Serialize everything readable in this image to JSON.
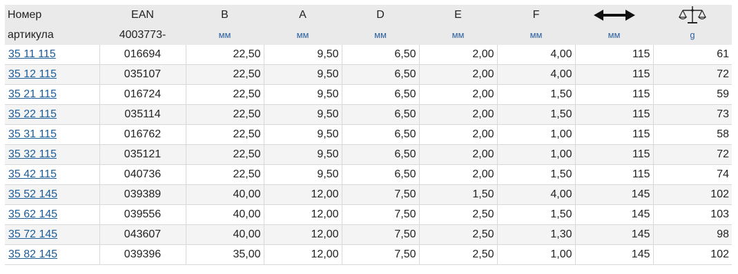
{
  "header": {
    "col_article_line1": "Номер",
    "col_article_line2": "артикула",
    "col_ean_line1": "EAN",
    "col_ean_line2": "4003773-",
    "col_b": "B",
    "col_a": "A",
    "col_d": "D",
    "col_e": "E",
    "col_f": "F",
    "length_icon": "double-arrow-icon",
    "weight_icon": "scale-icon",
    "units": {
      "b": "мм",
      "a": "мм",
      "d": "мм",
      "e": "мм",
      "f": "мм",
      "length": "мм",
      "weight": "g"
    }
  },
  "rows": [
    {
      "article": "35 11 115",
      "ean": "016694",
      "b": "22,50",
      "a": "9,50",
      "d": "6,50",
      "e": "2,00",
      "f": "4,00",
      "length": "115",
      "weight": "61"
    },
    {
      "article": "35 12 115",
      "ean": "035107",
      "b": "22,50",
      "a": "9,50",
      "d": "6,50",
      "e": "2,00",
      "f": "4,00",
      "length": "115",
      "weight": "72"
    },
    {
      "article": "35 21 115",
      "ean": "016724",
      "b": "22,50",
      "a": "9,50",
      "d": "6,50",
      "e": "2,00",
      "f": "1,50",
      "length": "115",
      "weight": "59"
    },
    {
      "article": "35 22 115",
      "ean": "035114",
      "b": "22,50",
      "a": "9,50",
      "d": "6,50",
      "e": "2,00",
      "f": "1,50",
      "length": "115",
      "weight": "73"
    },
    {
      "article": "35 31 115",
      "ean": "016762",
      "b": "22,50",
      "a": "9,50",
      "d": "6,50",
      "e": "2,00",
      "f": "1,00",
      "length": "115",
      "weight": "58"
    },
    {
      "article": "35 32 115",
      "ean": "035121",
      "b": "22,50",
      "a": "9,50",
      "d": "6,50",
      "e": "2,00",
      "f": "1,00",
      "length": "115",
      "weight": "72"
    },
    {
      "article": "35 42 115",
      "ean": "040736",
      "b": "22,50",
      "a": "9,50",
      "d": "6,50",
      "e": "2,00",
      "f": "1,50",
      "length": "115",
      "weight": "74"
    },
    {
      "article": "35 52 145",
      "ean": "039389",
      "b": "40,00",
      "a": "12,00",
      "d": "7,50",
      "e": "1,50",
      "f": "4,00",
      "length": "145",
      "weight": "102"
    },
    {
      "article": "35 62 145",
      "ean": "039556",
      "b": "40,00",
      "a": "12,00",
      "d": "7,50",
      "e": "2,50",
      "f": "1,50",
      "length": "145",
      "weight": "103"
    },
    {
      "article": "35 72 145",
      "ean": "043607",
      "b": "40,00",
      "a": "12,00",
      "d": "7,50",
      "e": "2,50",
      "f": "1,30",
      "length": "145",
      "weight": "98"
    },
    {
      "article": "35 82 145",
      "ean": "039396",
      "b": "35,00",
      "a": "12,00",
      "d": "7,50",
      "e": "2,50",
      "f": "1,00",
      "length": "145",
      "weight": "102"
    }
  ],
  "colors": {
    "link": "#1a5b99",
    "unit": "#2a5f9e",
    "header_bg": "#eaeaea",
    "row_alt_bg": "#f4f4f4"
  }
}
